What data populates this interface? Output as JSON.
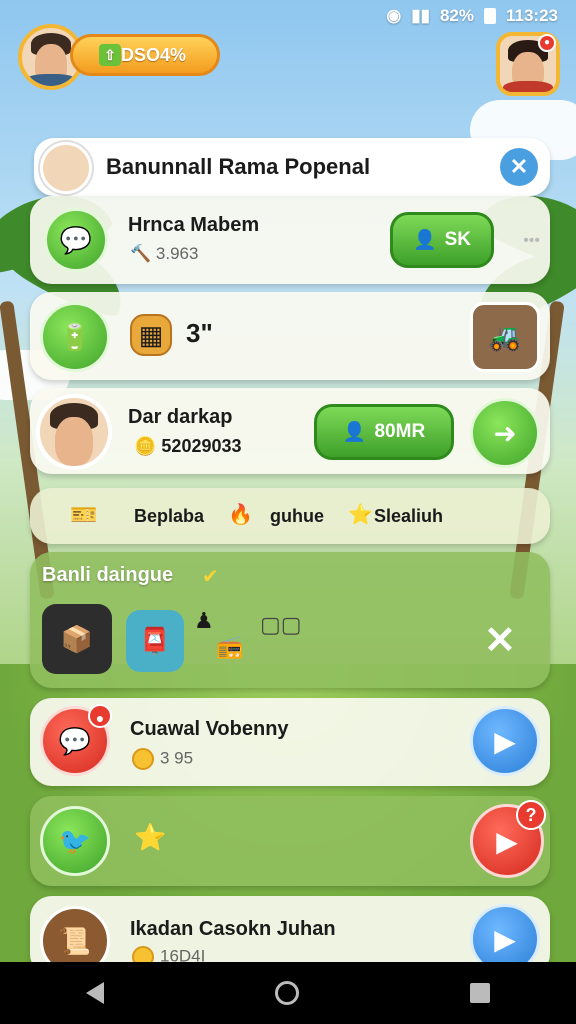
{
  "status_bar": {
    "battery": "82%",
    "time": "113:23"
  },
  "header": {
    "coins": "1DSO4%"
  },
  "title_card": {
    "title": "Banunnall Rama Popenal"
  },
  "row1": {
    "name": "Hrnca Mabem",
    "value": "3.963",
    "button": "SK"
  },
  "row2": {
    "value": "3\""
  },
  "row3": {
    "name": "Dar darkap",
    "value": "52029033",
    "button": "80MR"
  },
  "bonus_strip": {
    "text_a": "Beplaba",
    "text_b": "guhue",
    "text_c": "Slealiuh"
  },
  "dialog": {
    "title": "Banli daingue"
  },
  "row4": {
    "name": "Cuawal Vobenny",
    "value": "3 95"
  },
  "row6": {
    "name": "Ikadan Casokn Juhan",
    "value": "16D4I"
  },
  "colors": {
    "accent_green": "#3ea02a",
    "accent_blue": "#2a7fd8",
    "accent_red": "#d42a1e",
    "coin_gold": "#f6c232"
  }
}
